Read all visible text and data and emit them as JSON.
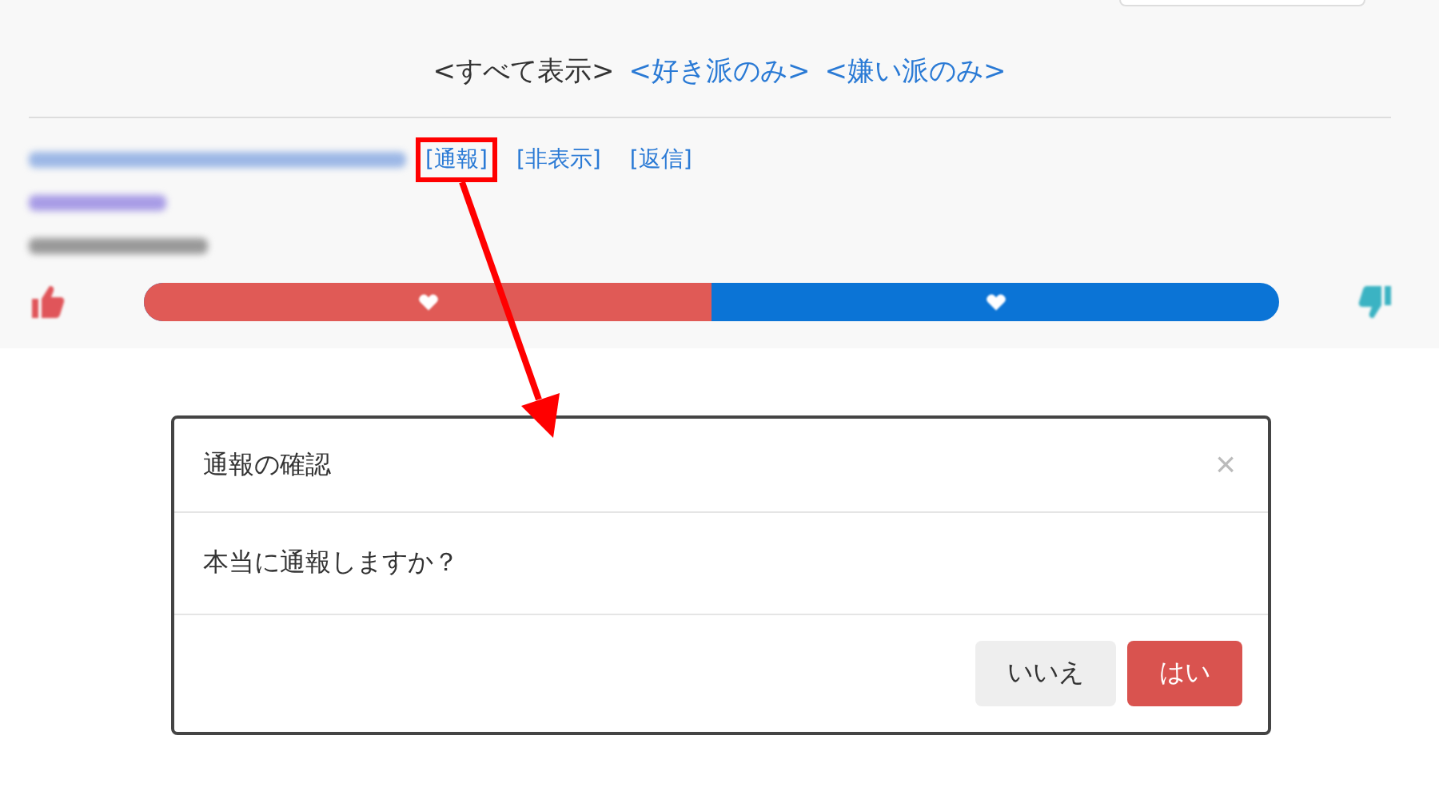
{
  "filters": [
    {
      "label": "<すべて表示>",
      "selected": true
    },
    {
      "label": "<好き派のみ>",
      "selected": false
    },
    {
      "label": "<嫌い派のみ>",
      "selected": false
    }
  ],
  "comment": {
    "actions": [
      {
        "label": "[通報]",
        "annotated": true
      },
      {
        "label": "[非表示]",
        "annotated": false
      },
      {
        "label": "[返信]",
        "annotated": false
      }
    ],
    "vote": {
      "level": 0.5
    }
  },
  "dialog": {
    "title": "通報の確認",
    "close": "×",
    "message": "本当に通報しますか？",
    "buttons": [
      {
        "label": "いいえ",
        "kind": "secondary"
      },
      {
        "label": "はい",
        "kind": "danger"
      }
    ]
  }
}
